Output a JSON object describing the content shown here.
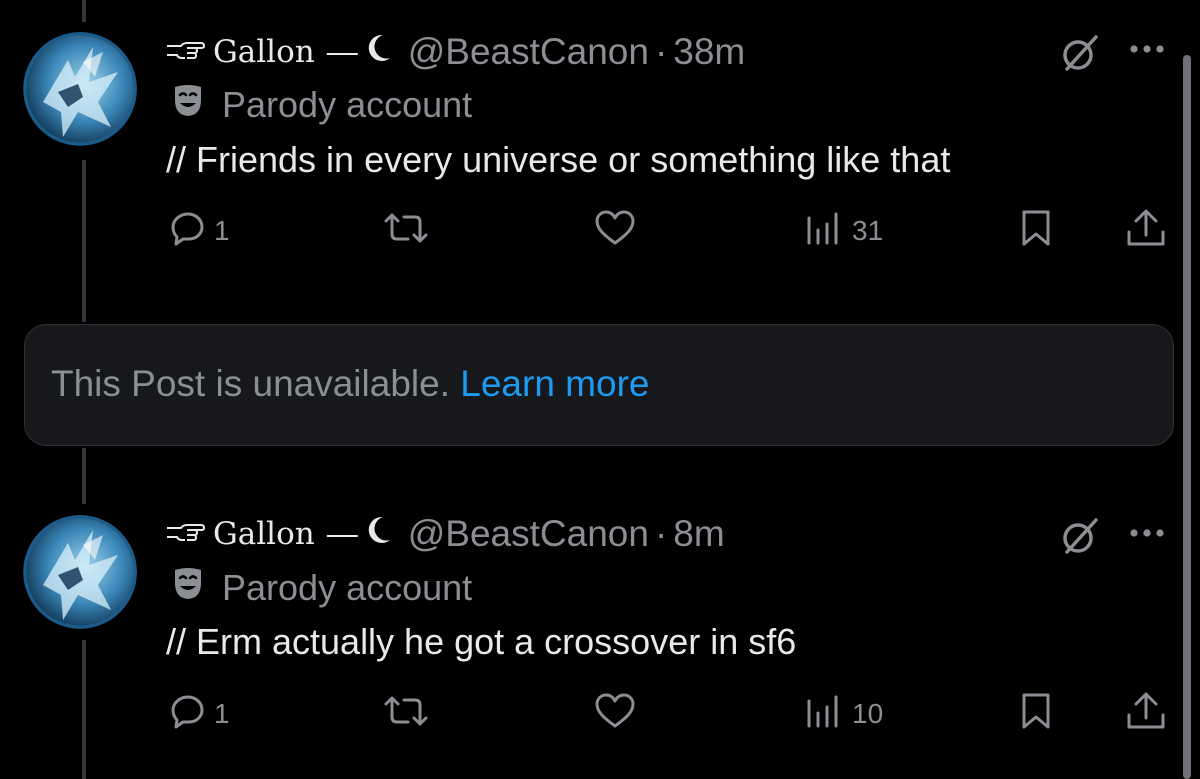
{
  "posts": [
    {
      "display_name": "Gallon",
      "handle": "@BeastCanon",
      "separator": "·",
      "time": "38m",
      "badge_label": "Parody account",
      "text": "// Friends in every universe or something like that",
      "actions": {
        "reply_count": "1",
        "repost_count": "",
        "like_count": "",
        "views_count": "31"
      }
    },
    {
      "display_name": "Gallon",
      "handle": "@BeastCanon",
      "separator": "·",
      "time": "8m",
      "badge_label": "Parody account",
      "text": "// Erm actually he got a crossover in sf6",
      "actions": {
        "reply_count": "1",
        "repost_count": "",
        "like_count": "",
        "views_count": "10"
      }
    }
  ],
  "unavailable_notice": {
    "message": "This Post is unavailable.",
    "link_label": "Learn more"
  },
  "name_decorations": {
    "prefix_icon": "pointing-hand-icon",
    "dash": "—",
    "suffix_icon": "crescent-moon-icon"
  },
  "icons": {
    "reply": "reply-icon",
    "repost": "repost-icon",
    "like": "heart-icon",
    "views": "views-chart-icon",
    "bookmark": "bookmark-icon",
    "share": "share-icon",
    "grok": "grok-icon",
    "more": "more-dots-icon",
    "parody": "theater-mask-icon"
  },
  "colors": {
    "background": "#000000",
    "primary_text": "#e7e9ea",
    "secondary_text": "#8b8e93",
    "link": "#1d9bf0",
    "notice_background": "#16181c",
    "thread_line": "#333639"
  }
}
